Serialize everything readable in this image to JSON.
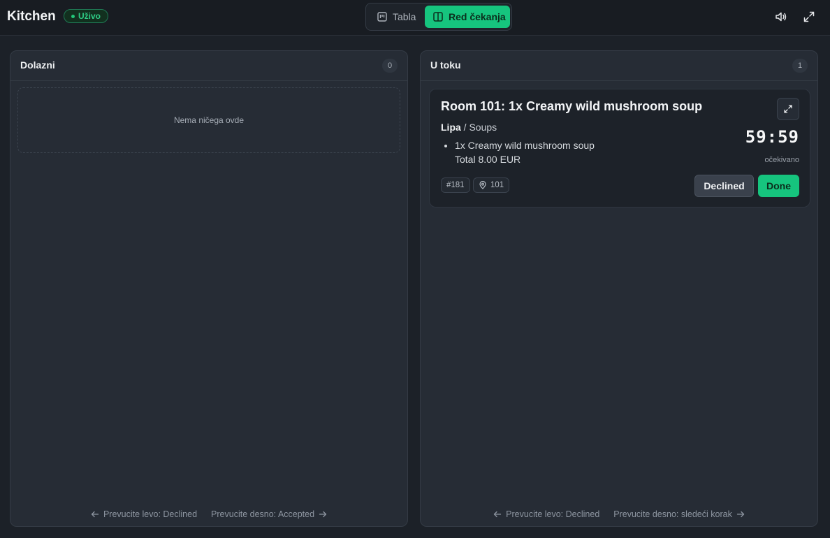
{
  "header": {
    "title": "Kitchen",
    "live_badge": "Uživo",
    "view_tabs": [
      {
        "label": "Tabla",
        "active": false,
        "icon": "board-icon"
      },
      {
        "label": "Red čekanja",
        "active": true,
        "icon": "columns-icon"
      }
    ],
    "actions": [
      "volume-icon",
      "fullscreen-icon"
    ]
  },
  "columns": [
    {
      "title": "Dolazni",
      "count": "0",
      "empty_text": "Nema ničega ovde",
      "hint_left": "Prevucite levo: Declined",
      "hint_right": "Prevucite desno: Accepted"
    },
    {
      "title": "U toku",
      "count": "1",
      "hint_left": "Prevucite levo: Declined",
      "hint_right": "Prevucite desno: sledeći korak",
      "order": {
        "title": "Room 101: 1x Creamy wild mushroom soup",
        "location": "Lipa",
        "category": "/ Soups",
        "item": "1x Creamy wild mushroom soup",
        "total": "Total 8.00 EUR",
        "timer": "59:59",
        "timer_label": "očekivano",
        "order_id": "#181",
        "room": "101",
        "decline_label": "Declined",
        "done_label": "Done"
      }
    }
  ],
  "colors": {
    "accent": "#16c47e",
    "background": "#1c2128",
    "panel": "#262c35",
    "card": "#1d2229"
  }
}
